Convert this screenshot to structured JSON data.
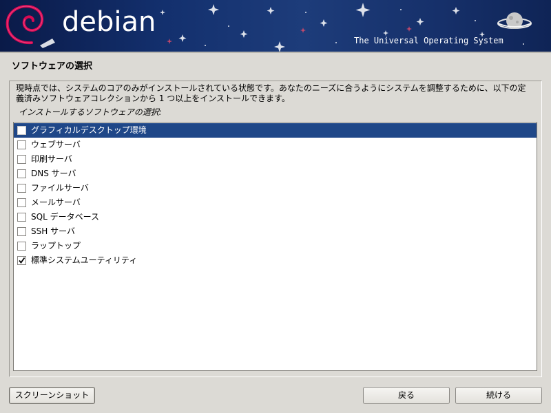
{
  "banner": {
    "logo_text": "debian",
    "tagline": "The Universal Operating System",
    "swirl_icon": "debian-swirl-icon",
    "planet_icon": "planet-icon",
    "colors": {
      "background": "#16306a",
      "swirl": "#d70a53"
    }
  },
  "page": {
    "title": "ソフトウェアの選択",
    "description_line1": "現時点では、システムのコアのみがインストールされている状態です。あなたのニーズに合うようにシステムを調整するために、以下の定",
    "description_line2": "義済みソフトウェアコレクションから 1 つ以上をインストールできます。",
    "prompt": "インストールするソフトウェアの選択:"
  },
  "software": {
    "items": [
      {
        "label": "グラフィカルデスクトップ環境",
        "checked": false,
        "selected": true
      },
      {
        "label": "ウェブサーバ",
        "checked": false,
        "selected": false
      },
      {
        "label": "印刷サーバ",
        "checked": false,
        "selected": false
      },
      {
        "label": "DNS サーバ",
        "checked": false,
        "selected": false
      },
      {
        "label": "ファイルサーバ",
        "checked": false,
        "selected": false
      },
      {
        "label": "メールサーバ",
        "checked": false,
        "selected": false
      },
      {
        "label": "SQL データベース",
        "checked": false,
        "selected": false
      },
      {
        "label": "SSH サーバ",
        "checked": false,
        "selected": false
      },
      {
        "label": "ラップトップ",
        "checked": false,
        "selected": false
      },
      {
        "label": "標準システムユーティリティ",
        "checked": true,
        "selected": false
      }
    ],
    "colors": {
      "selected_background": "#1f4788",
      "selected_text": "#ffffff"
    }
  },
  "buttons": {
    "screenshot": "スクリーンショット",
    "back": "戻る",
    "continue": "続ける"
  }
}
